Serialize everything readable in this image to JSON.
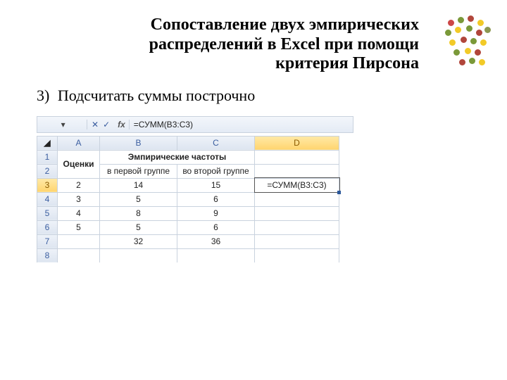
{
  "title": "Сопоставление двух эмпирических распределений в Excel при помощи критерия Пирсона",
  "step": {
    "num": "3)",
    "text": "Подсчитать  суммы построчно"
  },
  "excel": {
    "formula_bar": "=СУММ(B3:C3)",
    "fx": "fx",
    "icons": {
      "cancel": "✕",
      "enter": "✓"
    },
    "cols": {
      "A": "A",
      "B": "B",
      "C": "C",
      "D": "D"
    },
    "rows": [
      "1",
      "2",
      "3",
      "4",
      "5",
      "6",
      "7",
      "8"
    ],
    "cells": {
      "A1": "Оценки",
      "BC1": "Эмпирические частоты",
      "B2": "в первой группе",
      "C2": "во второй группе",
      "D3_formula": "=СУММ(B3:C3)"
    }
  },
  "chart_data": {
    "type": "table",
    "columns": [
      "Оценки",
      "Эмпирические частоты — в первой группе",
      "Эмпирические частоты — во второй группе"
    ],
    "rows": [
      {
        "grade": 2,
        "group1": 14,
        "group2": 15
      },
      {
        "grade": 3,
        "group1": 5,
        "group2": 6
      },
      {
        "grade": 4,
        "group1": 8,
        "group2": 9
      },
      {
        "grade": 5,
        "group1": 5,
        "group2": 6
      }
    ],
    "totals": {
      "group1": 32,
      "group2": 36
    }
  }
}
